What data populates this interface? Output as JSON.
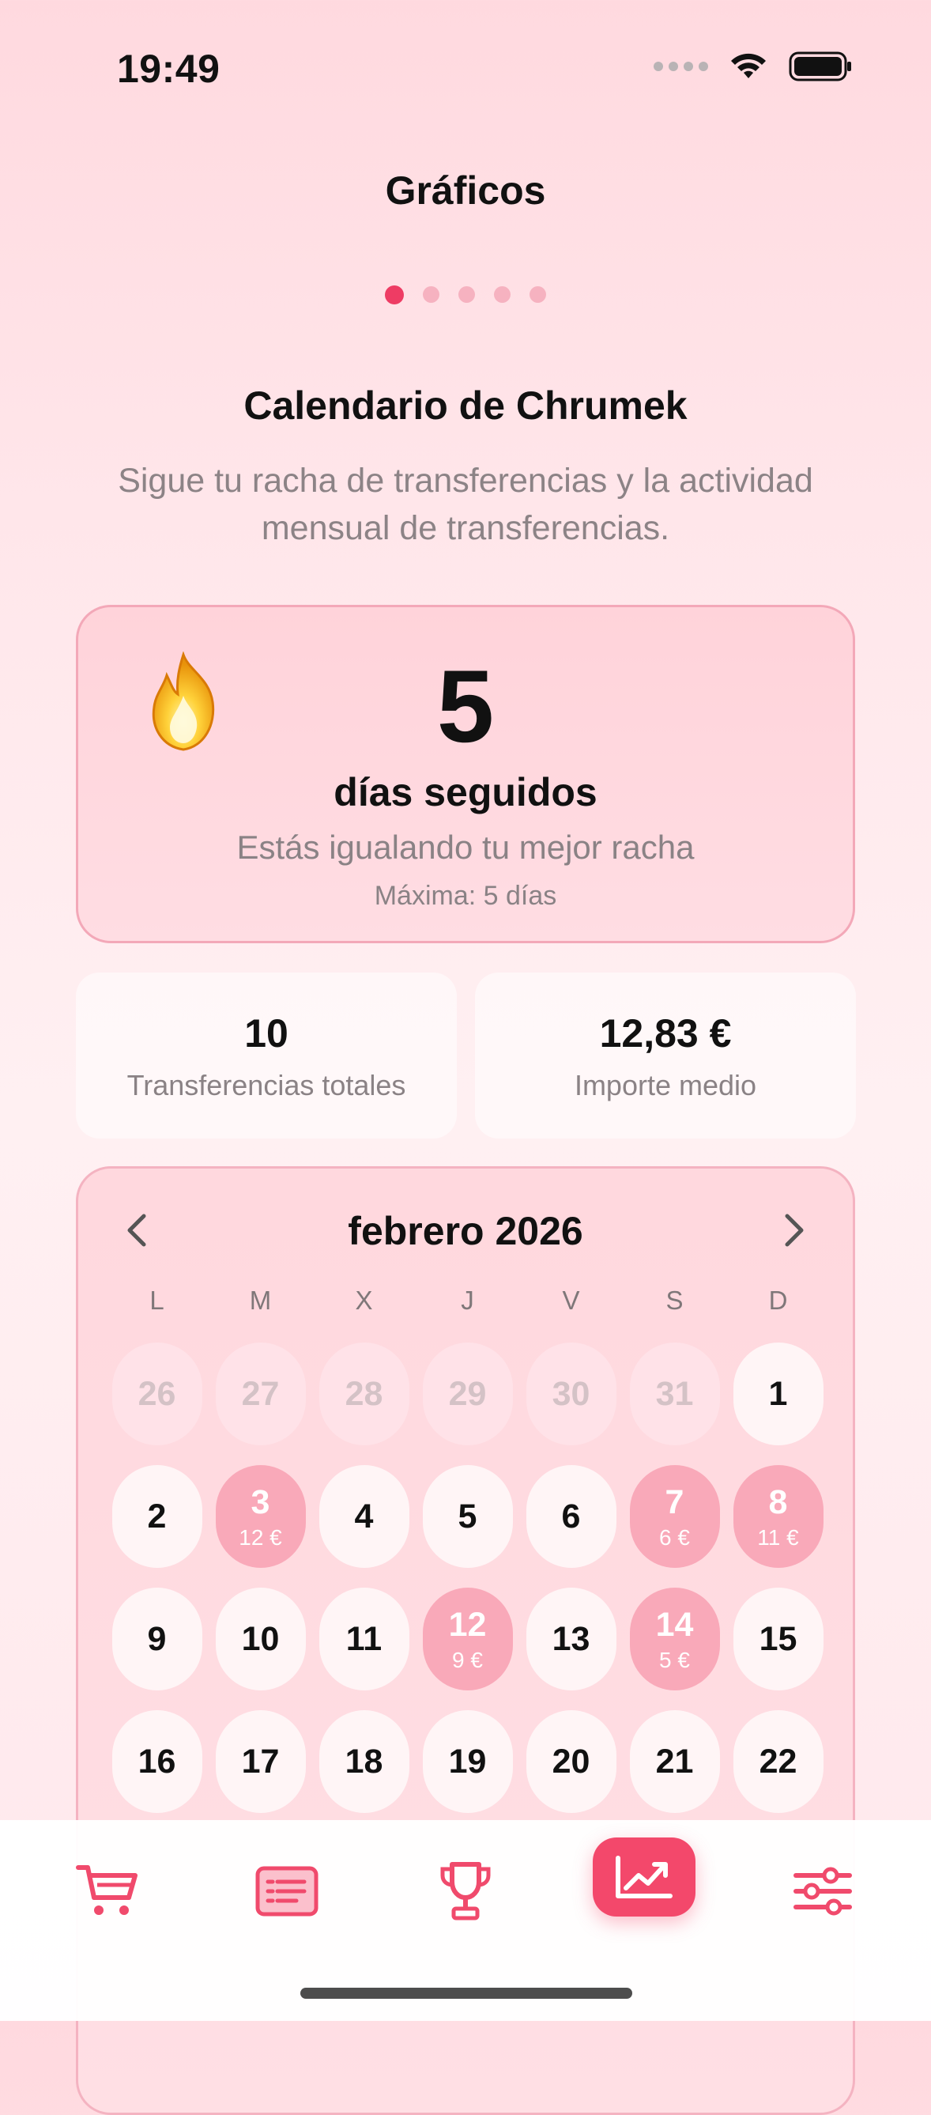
{
  "status_bar": {
    "time": "19:49"
  },
  "header": {
    "title": "Gráficos",
    "page_count": 5,
    "active_page": 1
  },
  "intro": {
    "title": "Calendario de Chrumek",
    "description": "Sigue tu racha de transferencias y la actividad mensual de transferencias."
  },
  "streak": {
    "icon": "fire-icon",
    "count": "5",
    "label": "días seguidos",
    "subtitle": "Estás igualando tu mejor racha",
    "max": "Máxima: 5 días"
  },
  "stats": {
    "total_transfers": {
      "value": "10",
      "label": "Transferencias totales"
    },
    "average_amount": {
      "value": "12,83 €",
      "label": "Importe medio"
    }
  },
  "calendar": {
    "month": "febrero 2026",
    "weekdays": [
      "L",
      "M",
      "X",
      "J",
      "V",
      "S",
      "D"
    ],
    "weeks": [
      [
        {
          "day": "26",
          "other": true
        },
        {
          "day": "27",
          "other": true
        },
        {
          "day": "28",
          "other": true
        },
        {
          "day": "29",
          "other": true
        },
        {
          "day": "30",
          "other": true
        },
        {
          "day": "31",
          "other": true
        },
        {
          "day": "1"
        }
      ],
      [
        {
          "day": "2"
        },
        {
          "day": "3",
          "amount": "12 €"
        },
        {
          "day": "4"
        },
        {
          "day": "5"
        },
        {
          "day": "6"
        },
        {
          "day": "7",
          "amount": "6 €"
        },
        {
          "day": "8",
          "amount": "11 €"
        }
      ],
      [
        {
          "day": "9"
        },
        {
          "day": "10"
        },
        {
          "day": "11"
        },
        {
          "day": "12",
          "amount": "9 €"
        },
        {
          "day": "13"
        },
        {
          "day": "14",
          "amount": "5 €"
        },
        {
          "day": "15"
        }
      ],
      [
        {
          "day": "16"
        },
        {
          "day": "17"
        },
        {
          "day": "18"
        },
        {
          "day": "19"
        },
        {
          "day": "20"
        },
        {
          "day": "21"
        },
        {
          "day": "22"
        }
      ]
    ]
  },
  "tab_bar": {
    "tabs": [
      {
        "icon": "cart-icon",
        "active": false
      },
      {
        "icon": "list-icon",
        "active": false
      },
      {
        "icon": "trophy-icon",
        "active": false
      },
      {
        "icon": "chart-icon",
        "active": true
      },
      {
        "icon": "sliders-icon",
        "active": false
      }
    ]
  },
  "colors": {
    "accent": "#f3486b",
    "active_day": "#f9a9b9",
    "page_dot_active": "#ee3c64"
  }
}
